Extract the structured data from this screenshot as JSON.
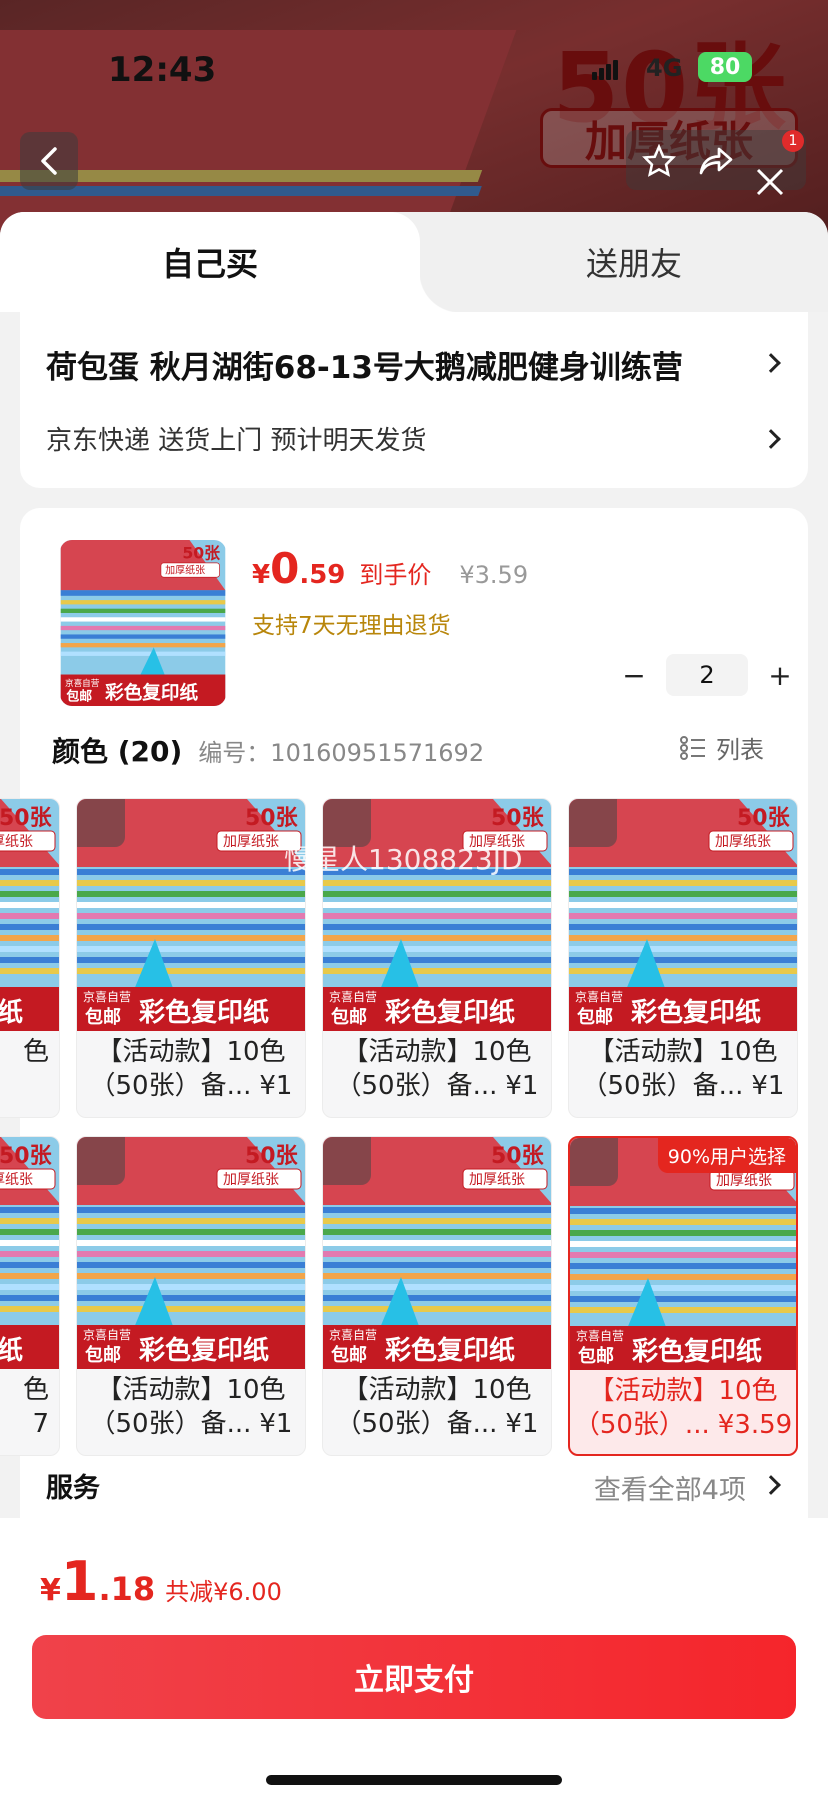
{
  "status_bar": {
    "time": "12:43",
    "network": "4G",
    "battery": "80"
  },
  "hero": {
    "big_text": "50张",
    "badge_text": "加厚纸张",
    "cart_count": "1"
  },
  "tabs": {
    "self": "自己买",
    "friend": "送朋友"
  },
  "address": {
    "line": "荷包蛋  秋月湖街68-13号大鹅减肥健身训练营",
    "shipping": "京东快递 送货上门 预计明天发货"
  },
  "product": {
    "price_yen": "¥",
    "price_int": "0",
    "price_dec": ".59",
    "price_label": "到手价",
    "original_price": "¥3.59",
    "return_note": "支持7天无理由退货",
    "quantity": "2",
    "minus": "−",
    "plus": "+"
  },
  "thumb_labels": {
    "count": "50张",
    "thick": "加厚纸张",
    "jd": "京喜自营",
    "free": "包邮",
    "name": "彩色复印纸"
  },
  "colors": {
    "title": "颜色 (20)",
    "code": "编号：10160951571692",
    "list_label": "列表",
    "watermark": "慢星人1308823JD",
    "hot_tag": "90%用户选择",
    "items": [
      {
        "line1": "【活动款】10色",
        "line2": "（50张）备...",
        "price": "¥1"
      },
      {
        "line1": "【活动款】10色",
        "line2": "（50张）备...",
        "price": "¥1"
      },
      {
        "line1": "【活动款】10色",
        "line2": "（50张）备...",
        "price": "¥1"
      },
      {
        "line1": "【活动款】10色",
        "line2": "（50张）备...",
        "price": "¥1"
      },
      {
        "line1": "【活动款】10色",
        "line2": "（50张）备...",
        "price": "¥1"
      },
      {
        "line1": "【活动款】10色",
        "line2": "（50张）...",
        "price": "¥3.59"
      }
    ],
    "left_partial": [
      {
        "line2": "色"
      },
      {
        "line2": "色",
        "line3": "7"
      }
    ]
  },
  "service": {
    "title": "服务",
    "view_all": "查看全部4项"
  },
  "footer": {
    "yen": "¥",
    "int": "1",
    "dec": ".18",
    "saving": "共减¥6.00",
    "pay_label": "立即支付"
  },
  "colors_theme": {
    "accent": "#e4261f",
    "tag": "#b8860b"
  }
}
